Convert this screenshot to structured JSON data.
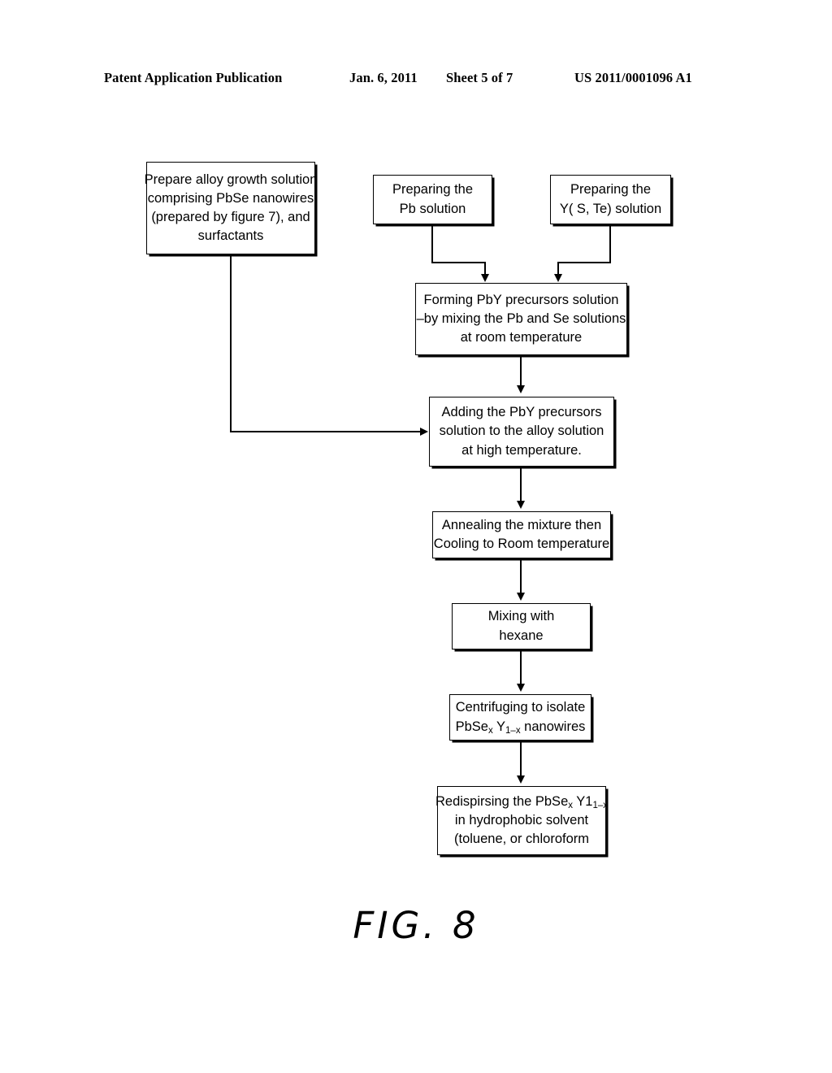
{
  "header": {
    "title": "Patent Application Publication",
    "date": "Jan. 6, 2011",
    "sheet": "Sheet 5 of 7",
    "patent_number": "US 2011/0001096 A1"
  },
  "figure": {
    "caption": "FIG. 8",
    "type": "process-flow-diagram",
    "accent_color": "#000000",
    "background_color": "#ffffff"
  },
  "nodes": {
    "alloy_growth": {
      "id": "prepare-alloy-growth-solution",
      "lines": [
        "Prepare alloy growth solution",
        "comprising PbSe nanowires",
        "(prepared by figure 7), and",
        "surfactants"
      ]
    },
    "pb_solution": {
      "id": "preparing-pb-solution",
      "lines": [
        "Preparing the",
        "Pb solution"
      ]
    },
    "y_solution": {
      "id": "preparing-y-solution",
      "lines": [
        "Preparing the",
        "Y( S, Te) solution"
      ]
    },
    "forming_pby": {
      "id": "forming-pby-precursors-solution",
      "lines": [
        "Forming PbY precursors solution",
        "–by mixing the Pb and Se solutions",
        "at room temperature"
      ]
    },
    "adding_pby": {
      "id": "adding-pby-precursors",
      "lines": [
        "Adding the PbY precursors",
        "solution to the alloy solution",
        "at high temperature."
      ]
    },
    "annealing": {
      "id": "annealing-and-cooling",
      "lines": [
        "Annealing the mixture then",
        "Cooling to Room temperature"
      ]
    },
    "mixing_hexane": {
      "id": "mixing-with-hexane",
      "lines": [
        "Mixing with",
        "hexane"
      ]
    },
    "centrifuging": {
      "id": "centrifuging-to-isolate",
      "line1": "Centrifuging to isolate",
      "line2_parts": {
        "a": "PbSe",
        "a_sub": "x",
        "b": " Y",
        "b_sub": "1–x",
        "c": " nanowires"
      }
    },
    "redispersing": {
      "id": "redispirsing-nanowires",
      "line1_parts": {
        "a": "Redispirsing the PbSe",
        "a_sub": "x",
        "b": " Y1",
        "b_sub": "1–x"
      },
      "line2": "in hydrophobic solvent",
      "line3": "(toluene, or chloroform"
    }
  },
  "edges": [
    {
      "from": "preparing-pb-solution",
      "to": "forming-pby-precursors-solution",
      "style": "elbow-down"
    },
    {
      "from": "preparing-y-solution",
      "to": "forming-pby-precursors-solution",
      "style": "elbow-down"
    },
    {
      "from": "prepare-alloy-growth-solution",
      "to": "adding-pby-precursors",
      "style": "elbow-right"
    },
    {
      "from": "forming-pby-precursors-solution",
      "to": "adding-pby-precursors",
      "style": "straight-down"
    },
    {
      "from": "adding-pby-precursors",
      "to": "annealing-and-cooling",
      "style": "straight-down"
    },
    {
      "from": "annealing-and-cooling",
      "to": "mixing-with-hexane",
      "style": "straight-down"
    },
    {
      "from": "mixing-with-hexane",
      "to": "centrifuging-to-isolate",
      "style": "straight-down"
    },
    {
      "from": "centrifuging-to-isolate",
      "to": "redispirsing-nanowires",
      "style": "straight-down"
    }
  ]
}
